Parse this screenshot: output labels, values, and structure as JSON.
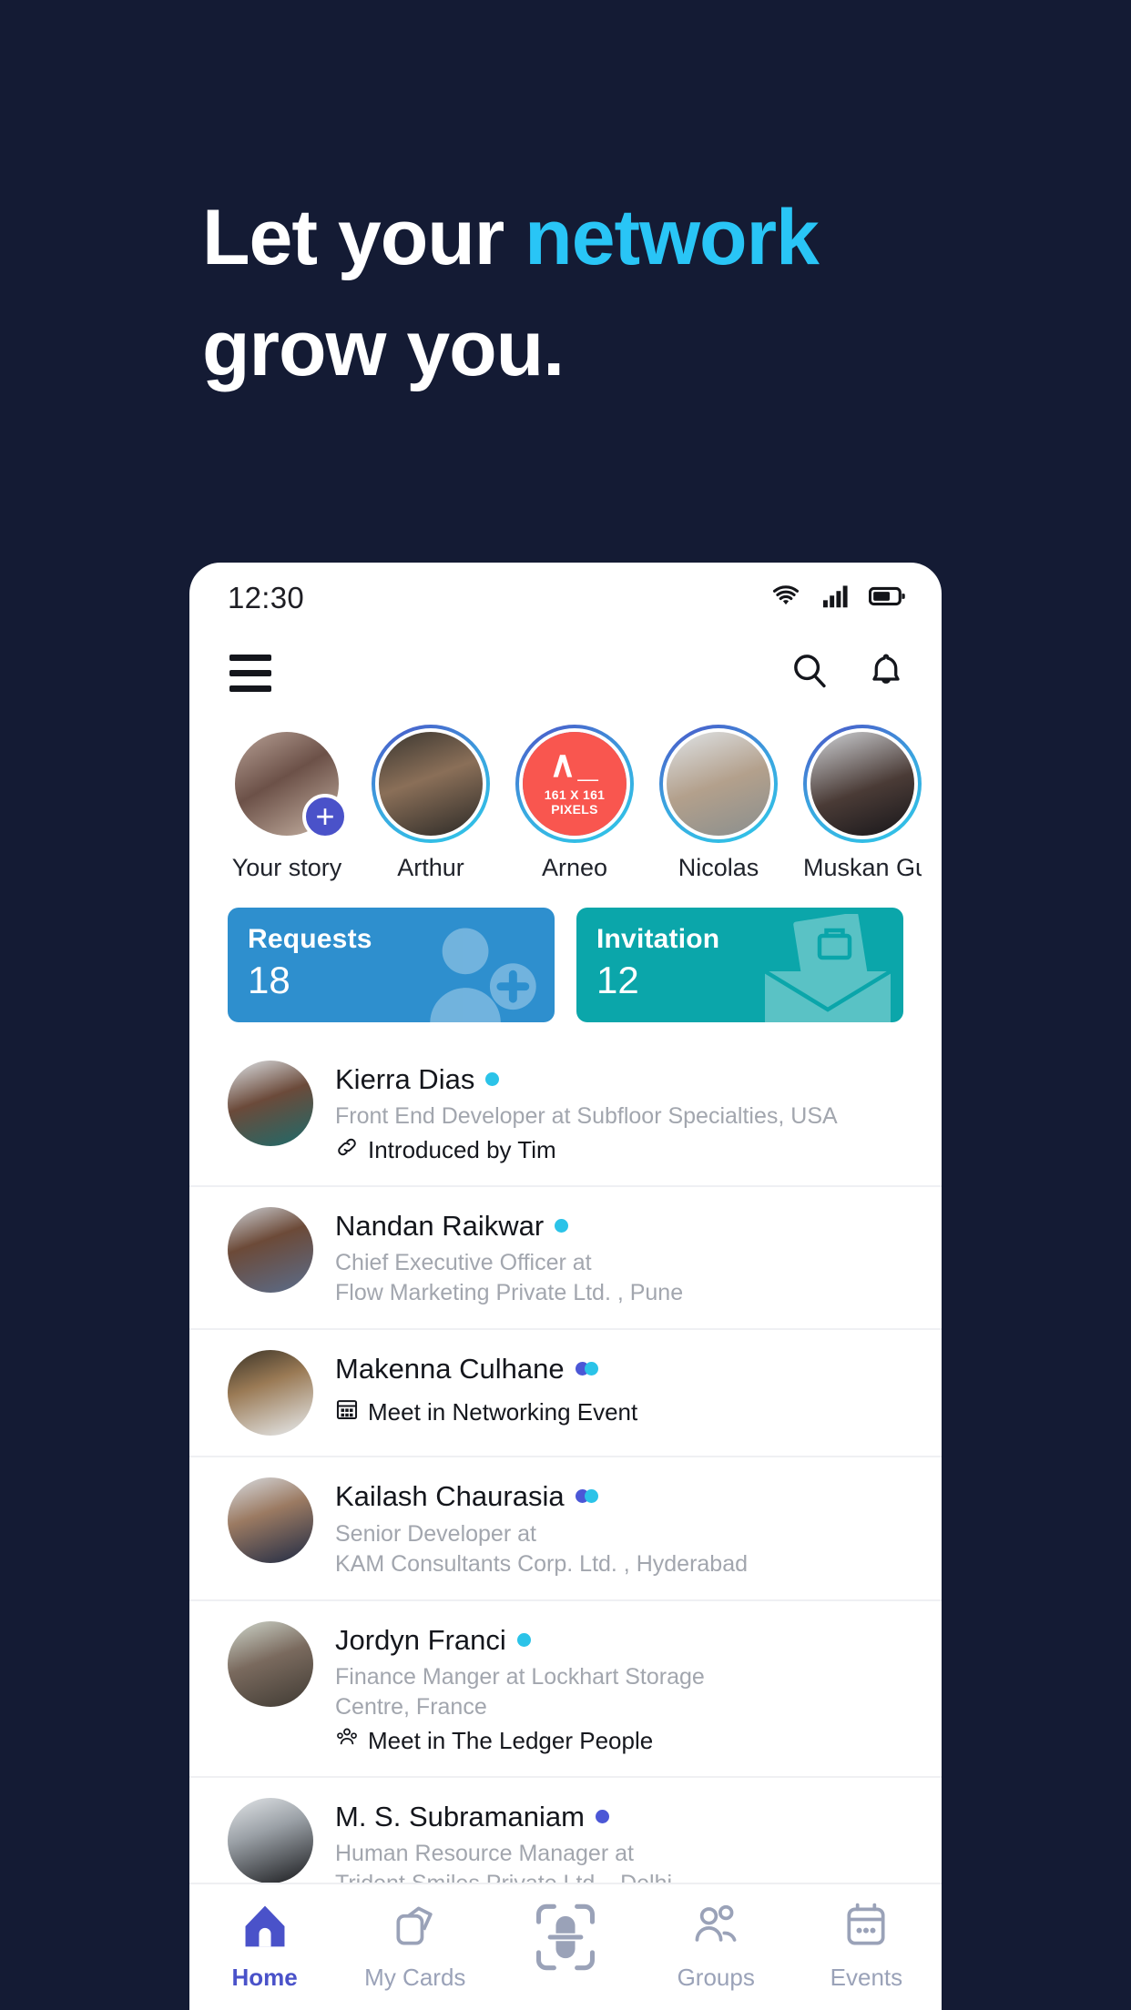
{
  "promo": {
    "line1_plain": "Let your ",
    "line1_accent": "network",
    "line2": "grow you.",
    "background_color": "#141B34",
    "accent_color": "#29C5F6"
  },
  "statusbar": {
    "time": "12:30",
    "icons": [
      "wifi-icon",
      "signal-icon",
      "battery-icon"
    ]
  },
  "appbar": {
    "menu_icon": "hamburger-menu-icon",
    "search_icon": "search-icon",
    "notifications_icon": "bell-icon"
  },
  "stories": [
    {
      "name": "Your story",
      "has_add": true,
      "ringed": false,
      "photo": "p1"
    },
    {
      "name": "Arthur",
      "has_add": false,
      "ringed": true,
      "photo": "p2"
    },
    {
      "name": "Arneo",
      "has_add": false,
      "ringed": true,
      "photo": "placeholder",
      "placeholder_glyph": "∧_",
      "placeholder_text": "161 X 161 PIXELS"
    },
    {
      "name": "Nicolas",
      "has_add": false,
      "ringed": true,
      "photo": "p4"
    },
    {
      "name": "Muskan Gupta",
      "has_add": false,
      "ringed": true,
      "photo": "p5"
    }
  ],
  "stat_cards": [
    {
      "label": "Requests",
      "value": "18",
      "color": "#2E8FCE",
      "art": "person-add-icon"
    },
    {
      "label": "Invitation",
      "value": "12",
      "color": "#0BA6AA",
      "art": "envelope-briefcase-icon"
    }
  ],
  "contacts": [
    {
      "name": "Kierra Dias",
      "badges": [
        "cyan"
      ],
      "subtitle": "Front End Developer at Subfloor Specialties, USA",
      "meta": "Introduced by Tim",
      "meta_icon": "link-icon",
      "avatar": "a1"
    },
    {
      "name": "Nandan Raikwar",
      "badges": [
        "cyan"
      ],
      "subtitle": "Chief Executive Officer at\nFlow Marketing Private Ltd. , Pune",
      "meta": "",
      "meta_icon": "",
      "avatar": "a2"
    },
    {
      "name": "Makenna Culhane",
      "badges": [
        "blue",
        "cyan"
      ],
      "subtitle": "",
      "meta": "Meet in Networking Event",
      "meta_icon": "calendar-icon",
      "avatar": "a3"
    },
    {
      "name": "Kailash Chaurasia",
      "badges": [
        "blue",
        "cyan"
      ],
      "subtitle": "Senior Developer at\nKAM Consultants Corp. Ltd. , Hyderabad",
      "meta": "",
      "meta_icon": "",
      "avatar": "a4"
    },
    {
      "name": "Jordyn Franci",
      "badges": [
        "cyan"
      ],
      "subtitle": "Finance Manger at Lockhart Storage\nCentre, France",
      "meta": "Meet in The Ledger People",
      "meta_icon": "group-people-icon",
      "avatar": "a5"
    },
    {
      "name": "M. S. Subramaniam",
      "badges": [
        "blue"
      ],
      "subtitle": "Human Resource Manager at\nTrident Smiles Private Ltd. , Delhi",
      "meta": "",
      "meta_icon": "",
      "avatar": "a6"
    }
  ],
  "bottom_nav": [
    {
      "label": "Home",
      "icon": "home-icon",
      "active": true
    },
    {
      "label": "My Cards",
      "icon": "cards-icon",
      "active": false
    },
    {
      "label": "",
      "icon": "scan-icon",
      "active": false
    },
    {
      "label": "Groups",
      "icon": "groups-icon",
      "active": false
    },
    {
      "label": "Events",
      "icon": "calendar-events-icon",
      "active": false
    }
  ]
}
